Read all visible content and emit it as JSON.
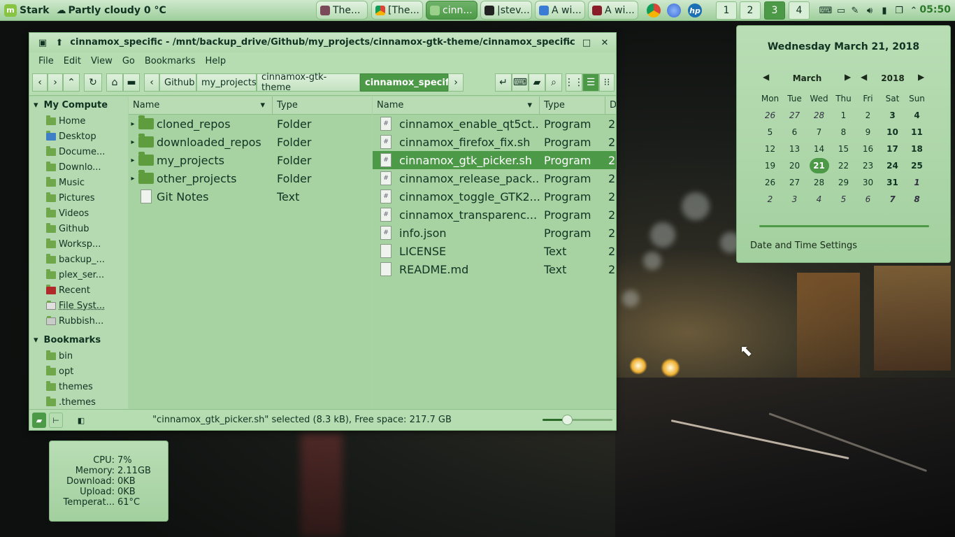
{
  "panel": {
    "menu_label": "Stark",
    "weather": "Partly cloudy 0 °C",
    "tasks": [
      {
        "label": "The..."
      },
      {
        "label": "[The..."
      },
      {
        "label": "cinn..."
      },
      {
        "label": "|stev..."
      },
      {
        "label": "A wi..."
      },
      {
        "label": "A wi..."
      }
    ],
    "workspaces": [
      "1",
      "2",
      "3",
      "4"
    ],
    "active_workspace": "3",
    "clock": "05:50"
  },
  "file_manager": {
    "title": "cinnamox_specific - /mnt/backup_drive/Github/my_projects/cinnamox-gtk-theme/cinnamox_specific",
    "menu": [
      "File",
      "Edit",
      "View",
      "Go",
      "Bookmarks",
      "Help"
    ],
    "breadcrumbs": [
      "Github",
      "my_projects",
      "cinnamox-gtk-theme",
      "cinnamox_specific"
    ],
    "sidebar": {
      "computer_header": "My Compute",
      "computer_items": [
        "Home",
        "Desktop",
        "Docume...",
        "Downlo...",
        "Music",
        "Pictures",
        "Videos",
        "Github",
        "Worksp...",
        "backup_...",
        "plex_ser...",
        "Recent",
        "File Syst...",
        "Rubbish..."
      ],
      "bookmarks_header": "Bookmarks",
      "bookmark_items": [
        "bin",
        "opt",
        "themes",
        ".themes"
      ]
    },
    "left_pane": {
      "columns": [
        "Name",
        "Type"
      ],
      "rows": [
        {
          "name": "cloned_repos",
          "type": "Folder"
        },
        {
          "name": "downloaded_repos",
          "type": "Folder"
        },
        {
          "name": "my_projects",
          "type": "Folder"
        },
        {
          "name": "other_projects",
          "type": "Folder"
        },
        {
          "name": "Git Notes",
          "type": "Text"
        }
      ]
    },
    "right_pane": {
      "columns": [
        "Name",
        "Type",
        "D"
      ],
      "rows": [
        {
          "name": "cinnamox_enable_qt5ct...",
          "type": "Program",
          "d": "2"
        },
        {
          "name": "cinnamox_firefox_fix.sh",
          "type": "Program",
          "d": "2"
        },
        {
          "name": "cinnamox_gtk_picker.sh",
          "type": "Program",
          "d": "2"
        },
        {
          "name": "cinnamox_release_pack...",
          "type": "Program",
          "d": "2"
        },
        {
          "name": "cinnamox_toggle_GTK2...",
          "type": "Program",
          "d": "2"
        },
        {
          "name": "cinnamox_transparenc...",
          "type": "Program",
          "d": "2"
        },
        {
          "name": "info.json",
          "type": "Program",
          "d": "2"
        },
        {
          "name": "LICENSE",
          "type": "Text",
          "d": "2"
        },
        {
          "name": "README.md",
          "type": "Text",
          "d": "2"
        }
      ],
      "selected_index": 2
    },
    "status": "\"cinnamox_gtk_picker.sh\" selected (8.3 kB), Free space: 217.7 GB",
    "zoom_fraction": 0.35
  },
  "calendar": {
    "full_date": "Wednesday March 21, 2018",
    "month": "March",
    "year": "2018",
    "weekdays": [
      "Mon",
      "Tue",
      "Wed",
      "Thu",
      "Fri",
      "Sat",
      "Sun"
    ],
    "weeks": [
      [
        "26",
        "27",
        "28",
        "1",
        "2",
        "3",
        "4"
      ],
      [
        "5",
        "6",
        "7",
        "8",
        "9",
        "10",
        "11"
      ],
      [
        "12",
        "13",
        "14",
        "15",
        "16",
        "17",
        "18"
      ],
      [
        "19",
        "20",
        "21",
        "22",
        "23",
        "24",
        "25"
      ],
      [
        "26",
        "27",
        "28",
        "29",
        "30",
        "31",
        "1"
      ],
      [
        "2",
        "3",
        "4",
        "5",
        "6",
        "7",
        "8"
      ]
    ],
    "today": "21",
    "settings_label": "Date and Time Settings"
  },
  "sysmon": {
    "rows": [
      {
        "k": "CPU:",
        "v": "7%"
      },
      {
        "k": "Memory:",
        "v": "2.11GB"
      },
      {
        "k": "Download:",
        "v": "0KB"
      },
      {
        "k": "Upload:",
        "v": "0KB"
      },
      {
        "k": "Temperat...",
        "v": "61°C"
      }
    ]
  },
  "colors": {
    "accent": "#4c9a47",
    "panel": "#b6dcb2"
  }
}
